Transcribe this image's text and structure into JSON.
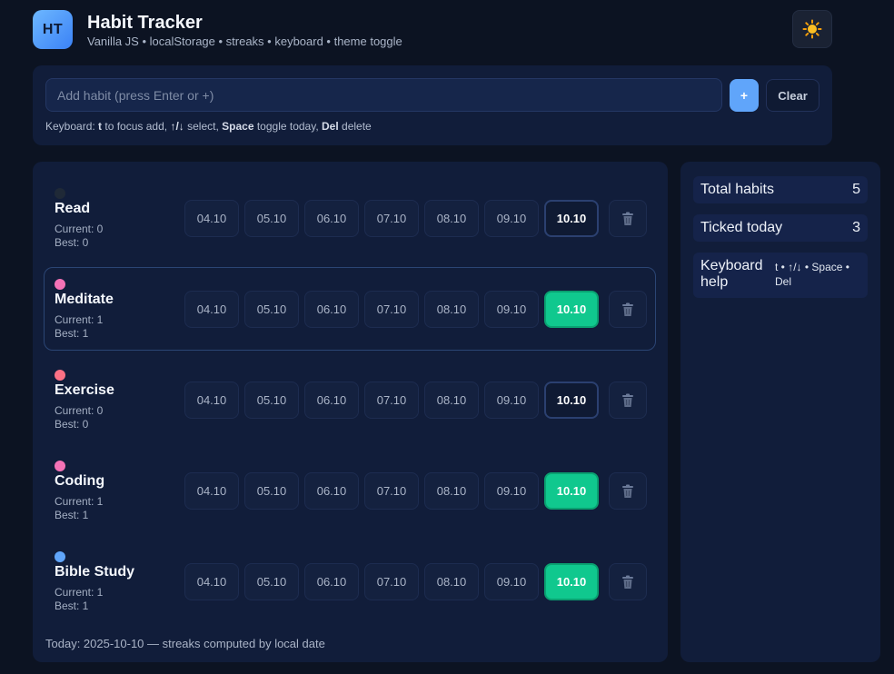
{
  "header": {
    "logo_text": "HT",
    "title": "Habit Tracker",
    "subtitle": "Vanilla JS • localStorage • streaks • keyboard • theme toggle",
    "theme_icon": "☀️"
  },
  "add_form": {
    "placeholder": "Add habit (press Enter or +)",
    "value": "",
    "add_label": "+",
    "clear_label": "Clear"
  },
  "keyboard_hint": {
    "prefix": "Keyboard: ",
    "key_t": "t",
    "text_focus": " to focus add, ",
    "key_arrows": "↑/↓",
    "text_select": " select, ",
    "key_space": "Space",
    "text_toggle": " toggle today, ",
    "key_del": "Del",
    "text_delete": " delete"
  },
  "habits": [
    {
      "name": "Read",
      "color": "#1f2937",
      "current": "Current: 0",
      "best": "Best: 0",
      "selected": false,
      "days": [
        "04.10",
        "05.10",
        "06.10",
        "07.10",
        "08.10",
        "09.10",
        "10.10"
      ],
      "today_done": false
    },
    {
      "name": "Meditate",
      "color": "#f472b6",
      "current": "Current: 1",
      "best": "Best: 1",
      "selected": true,
      "days": [
        "04.10",
        "05.10",
        "06.10",
        "07.10",
        "08.10",
        "09.10",
        "10.10"
      ],
      "today_done": true
    },
    {
      "name": "Exercise",
      "color": "#fb7185",
      "current": "Current: 0",
      "best": "Best: 0",
      "selected": false,
      "days": [
        "04.10",
        "05.10",
        "06.10",
        "07.10",
        "08.10",
        "09.10",
        "10.10"
      ],
      "today_done": false
    },
    {
      "name": "Coding",
      "color": "#f472b6",
      "current": "Current: 1",
      "best": "Best: 1",
      "selected": false,
      "days": [
        "04.10",
        "05.10",
        "06.10",
        "07.10",
        "08.10",
        "09.10",
        "10.10"
      ],
      "today_done": true
    },
    {
      "name": "Bible Study",
      "color": "#60a5fa",
      "current": "Current: 1",
      "best": "Best: 1",
      "selected": false,
      "days": [
        "04.10",
        "05.10",
        "06.10",
        "07.10",
        "08.10",
        "09.10",
        "10.10"
      ],
      "today_done": true
    }
  ],
  "delete_icon": "trash-icon",
  "footer": "Today: 2025-10-10 — streaks computed by local date",
  "stats": {
    "total_label": "Total habits",
    "total_value": "5",
    "ticked_label": "Ticked today",
    "ticked_value": "3",
    "help_label": "Keyboard help",
    "help_text": "t • ↑/↓ • Space • Del"
  },
  "colors": {
    "accent": "#60a5fa",
    "done": "#10c88e",
    "panel": "#111d3a",
    "background": "#0c1322"
  }
}
